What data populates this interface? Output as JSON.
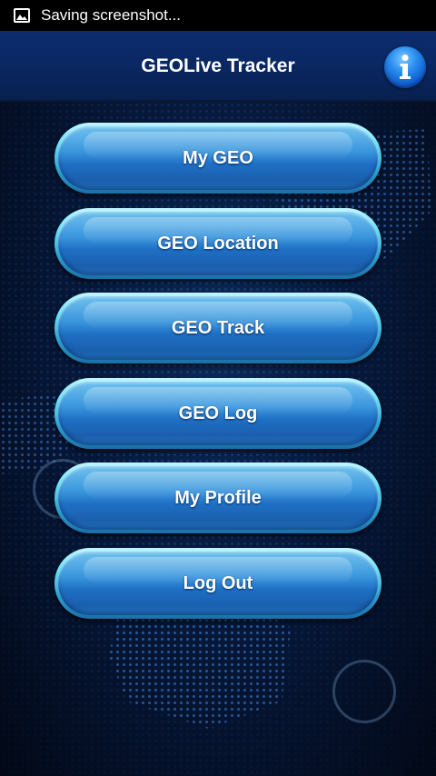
{
  "status_bar": {
    "notification_text": "Saving screenshot...",
    "icon": "image-icon"
  },
  "header": {
    "title": "GEOLive Tracker",
    "info_icon": "info-icon"
  },
  "menu": {
    "items": [
      {
        "label": "My GEO"
      },
      {
        "label": "GEO Location"
      },
      {
        "label": "GEO Track"
      },
      {
        "label": "GEO Log"
      },
      {
        "label": "My Profile"
      },
      {
        "label": "Log Out"
      }
    ]
  },
  "colors": {
    "header_bg": "#0a2760",
    "button_face": "#1e6fc4",
    "button_rim": "#6ee0f6",
    "background": "#06183a"
  }
}
